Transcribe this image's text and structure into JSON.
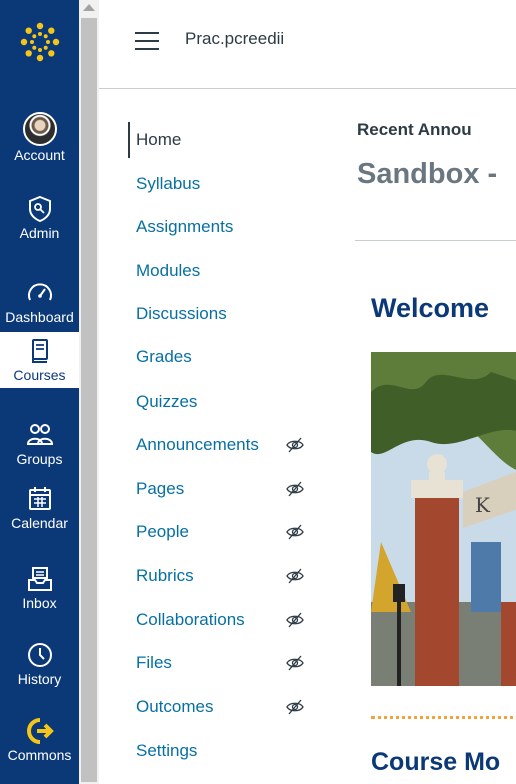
{
  "global_nav": {
    "items": [
      {
        "label": "Account",
        "icon": "user-avatar"
      },
      {
        "label": "Admin",
        "icon": "shield-icon"
      },
      {
        "label": "Dashboard",
        "icon": "speedometer-icon"
      },
      {
        "label": "Courses",
        "icon": "book-icon"
      },
      {
        "label": "Groups",
        "icon": "people-icon"
      },
      {
        "label": "Calendar",
        "icon": "calendar-icon"
      },
      {
        "label": "Inbox",
        "icon": "inbox-icon"
      },
      {
        "label": "History",
        "icon": "clock-icon"
      },
      {
        "label": "Commons",
        "icon": "arrow-right-icon"
      }
    ]
  },
  "header": {
    "course_name": "Prac.pcreedii"
  },
  "course_nav": {
    "items": [
      {
        "label": "Home",
        "hidden": false
      },
      {
        "label": "Syllabus",
        "hidden": false
      },
      {
        "label": "Assignments",
        "hidden": false
      },
      {
        "label": "Modules",
        "hidden": false
      },
      {
        "label": "Discussions",
        "hidden": false
      },
      {
        "label": "Grades",
        "hidden": false
      },
      {
        "label": "Quizzes",
        "hidden": false
      },
      {
        "label": "Announcements",
        "hidden": true
      },
      {
        "label": "Pages",
        "hidden": true
      },
      {
        "label": "People",
        "hidden": true
      },
      {
        "label": "Rubrics",
        "hidden": true
      },
      {
        "label": "Collaborations",
        "hidden": true
      },
      {
        "label": "Files",
        "hidden": true
      },
      {
        "label": "Outcomes",
        "hidden": true
      },
      {
        "label": "Settings",
        "hidden": false
      }
    ]
  },
  "main": {
    "recent_announcements": "Recent Annou",
    "page_title": "Sandbox -",
    "welcome_heading": "Welcome",
    "modules_heading": "Course Mo"
  },
  "colors": {
    "nav_bg": "#0b3978",
    "link": "#0770a3",
    "heading": "#0b3978",
    "accent_dots": "#f2a33a"
  }
}
